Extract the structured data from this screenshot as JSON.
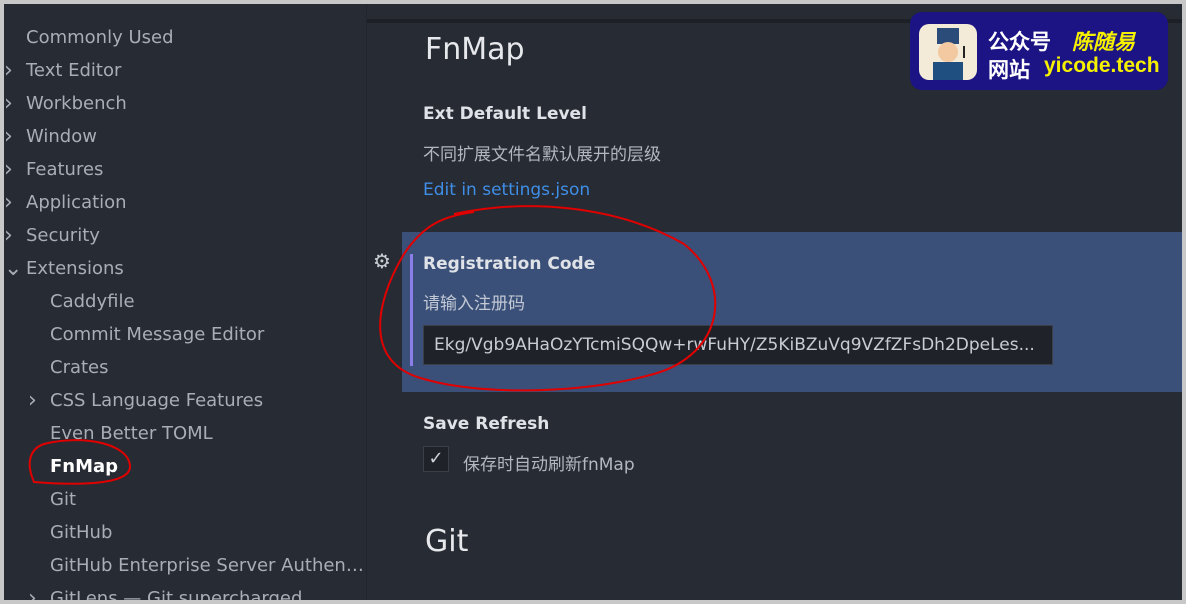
{
  "toc": {
    "items": [
      {
        "label": "Commonly Used",
        "chevron": "",
        "level": 0
      },
      {
        "label": "Text Editor",
        "chevron": "chevron-right",
        "level": 0
      },
      {
        "label": "Workbench",
        "chevron": "chevron-right",
        "level": 0
      },
      {
        "label": "Window",
        "chevron": "chevron-right",
        "level": 0
      },
      {
        "label": "Features",
        "chevron": "chevron-right",
        "level": 0
      },
      {
        "label": "Application",
        "chevron": "chevron-right",
        "level": 0
      },
      {
        "label": "Security",
        "chevron": "chevron-right",
        "level": 0
      },
      {
        "label": "Extensions",
        "chevron": "chevron-down",
        "level": 0
      },
      {
        "label": "Caddyfile",
        "chevron": "",
        "level": 1
      },
      {
        "label": "Commit Message Editor",
        "chevron": "",
        "level": 1
      },
      {
        "label": "Crates",
        "chevron": "",
        "level": 1
      },
      {
        "label": "CSS Language Features",
        "chevron": "chevron-right",
        "level": 1
      },
      {
        "label": "Even Better TOML",
        "chevron": "",
        "level": 1
      },
      {
        "label": "FnMap",
        "chevron": "",
        "level": 1,
        "active": true
      },
      {
        "label": "Git",
        "chevron": "",
        "level": 1
      },
      {
        "label": "GitHub",
        "chevron": "",
        "level": 1
      },
      {
        "label": "GitHub Enterprise Server Authentication Provider",
        "chevron": "",
        "level": 1
      },
      {
        "label": "GitLens — Git supercharged",
        "chevron": "chevron-right",
        "level": 1
      }
    ]
  },
  "main": {
    "section_title": "FnMap",
    "ext_default_level": {
      "label": "Ext Default Level",
      "description": "不同扩展文件名默认展开的层级",
      "link": "Edit in settings.json"
    },
    "registration_code": {
      "label": "Registration Code",
      "description": "请输入注册码",
      "value": "Ekg/Vgb9AHaOzYTcmiSQQw+rwFuHY/Z5KiBZuVq9VZfZFsDh2DpeLes..."
    },
    "save_refresh": {
      "label": "Save Refresh",
      "checkbox_label": "保存时自动刷新fnMap",
      "checked": true
    },
    "next_section_title": "Git"
  },
  "watermark": {
    "line1_label": "公众号",
    "line1_value": "陈随易",
    "line2_label": "网站",
    "line2_value": "yicode.tech"
  },
  "colors": {
    "background": "#272b33",
    "highlight": "#3b5079",
    "link": "#3f8ee8",
    "annotation": "#e00000"
  }
}
